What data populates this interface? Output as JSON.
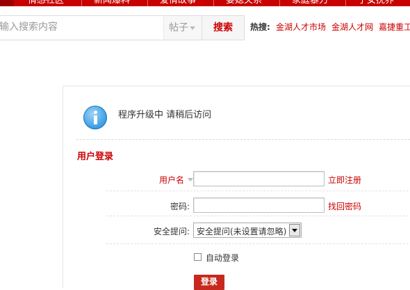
{
  "topnav": {
    "items": [
      "情感社区",
      "新闻爆料",
      "爱情故事",
      "婆媳关系",
      "家庭暴力",
      "子女抚养"
    ]
  },
  "search": {
    "placeholder": "请输入搜索内容",
    "type_value": "帖子",
    "button_label": "搜索",
    "hot_label": "热搜:",
    "hot_links": [
      "金湖人才市场",
      "金湖人才网",
      "嘉捷重工"
    ]
  },
  "notice": {
    "message": "程序升级中 请稍后访问"
  },
  "login": {
    "title": "用户登录",
    "username_label": "用户名",
    "register_link": "立即注册",
    "password_label": "密码:",
    "forgot_link": "找回密码",
    "question_label": "安全提问:",
    "question_value": "安全提问(未设置请忽略)",
    "auto_login_label": "自动登录",
    "submit_label": "登录"
  },
  "colors": {
    "brand_red": "#c80000",
    "link_red": "#cc0000",
    "info_blue": "#4aa7e6"
  }
}
